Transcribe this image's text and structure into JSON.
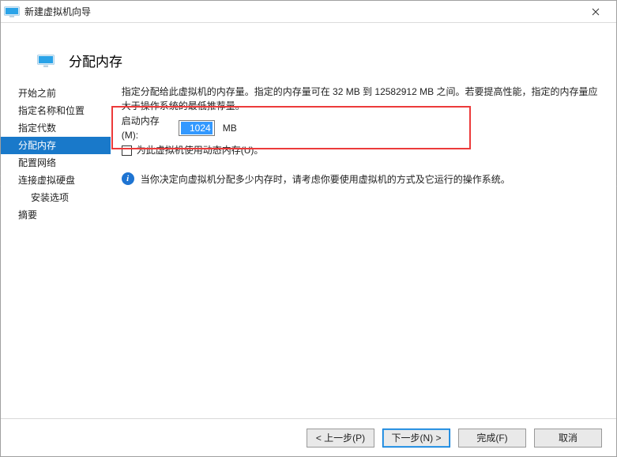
{
  "titlebar": {
    "title": "新建虚拟机向导"
  },
  "header": {
    "title": "分配内存"
  },
  "sidebar": {
    "items": [
      {
        "label": "开始之前"
      },
      {
        "label": "指定名称和位置"
      },
      {
        "label": "指定代数"
      },
      {
        "label": "分配内存",
        "selected": true
      },
      {
        "label": "配置网络"
      },
      {
        "label": "连接虚拟硬盘"
      },
      {
        "label": "安装选项",
        "indent": true
      },
      {
        "label": "摘要"
      }
    ]
  },
  "main": {
    "description": "指定分配给此虚拟机的内存量。指定的内存量可在 32 MB 到 12582912 MB 之间。若要提高性能，指定的内存量应大于操作系统的最低推荐量。",
    "startup_label": "启动内存(M):",
    "startup_value": "1024",
    "unit": "MB",
    "dynamic_checkbox_label": "为此虚拟机使用动态内存(U)。",
    "info_text": "当你决定向虚拟机分配多少内存时，请考虑你要使用虚拟机的方式及它运行的操作系统。"
  },
  "footer": {
    "prev": "< 上一步(P)",
    "next": "下一步(N) >",
    "finish": "完成(F)",
    "cancel": "取消"
  }
}
